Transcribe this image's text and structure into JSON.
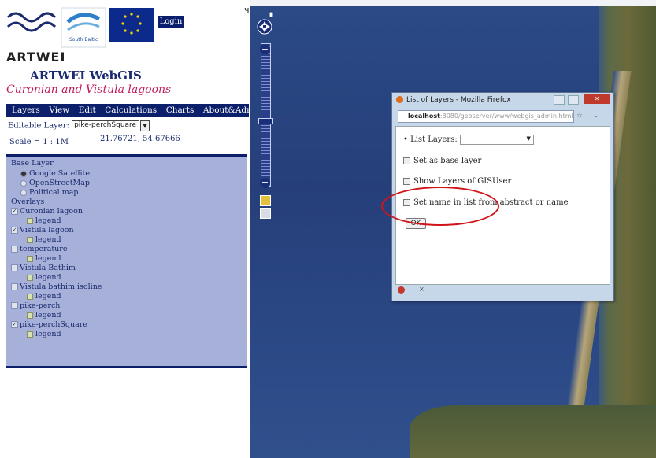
{
  "header": {
    "login_label": "Login",
    "brand": "ARTWEI",
    "app_title": "ARTWEI WebGIS",
    "subtitle": "Curonian and Vistula lagoons"
  },
  "menu": [
    "Layers",
    "View",
    "Edit",
    "Calculations",
    "Charts",
    "About&Admin"
  ],
  "editable_layer": {
    "label": "Editable Layer:",
    "value": "pike-perchSquare"
  },
  "scale": "Scale = 1 : 1M",
  "coordinates": "21.76721, 54.67666",
  "layers": {
    "base_header": "Base Layer",
    "base": [
      {
        "label": "Google Satellite",
        "selected": true
      },
      {
        "label": "OpenStreetMap",
        "selected": false
      },
      {
        "label": "Political map",
        "selected": false
      }
    ],
    "overlay_header": "Overlays",
    "overlays": [
      {
        "label": "Curonian lagoon",
        "checked": true,
        "legend": "legend"
      },
      {
        "label": "Vistula lagoon",
        "checked": true,
        "legend": "legend"
      },
      {
        "label": "temperature",
        "checked": false,
        "legend": "legend"
      },
      {
        "label": "Vistula Bathim",
        "checked": false,
        "legend": "legend"
      },
      {
        "label": "Vistula bathim isoline",
        "checked": false,
        "legend": "legend"
      },
      {
        "label": "pike-perch",
        "checked": false,
        "legend": "legend"
      },
      {
        "label": "pike-perchSquare",
        "checked": true,
        "legend": "legend"
      }
    ]
  },
  "popup": {
    "window_title": "List of Layers - Mozilla Firefox",
    "url_host": "localhost",
    "url_path": ":8080/geoserver/www/webgis_admin.html#",
    "list_layers_label": "List Layers:",
    "set_base_label": "Set as base layer",
    "show_gisuser_label": "Show Layers of GISUser",
    "set_name_label": "Set name in list from abstract or name",
    "ok_label": "OK",
    "status_text": "×"
  },
  "colors": {
    "menu_bg": "#0b1f6a",
    "panel_bg": "#a6b0d8",
    "subtitle": "#c2185b",
    "highlight": "#d0141a"
  }
}
